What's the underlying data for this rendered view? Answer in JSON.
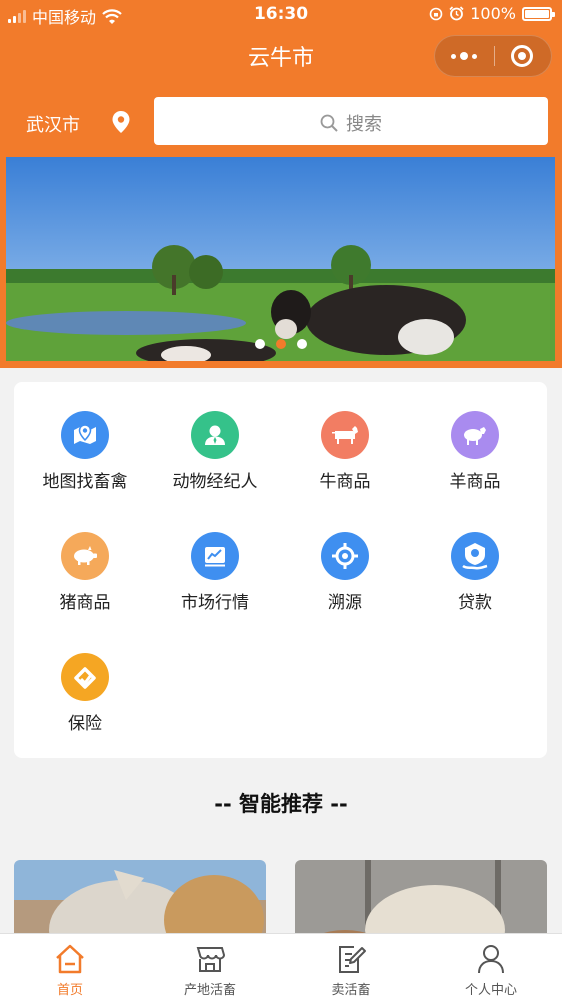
{
  "status_bar": {
    "carrier": "中国移动",
    "time": "16:30",
    "battery": "100%"
  },
  "nav": {
    "title": "云牛市"
  },
  "location": {
    "city": "武汉市"
  },
  "search": {
    "placeholder": "搜索"
  },
  "banner": {
    "slide_count": 3,
    "active_index": 1
  },
  "categories": [
    {
      "label": "地图找畜禽",
      "icon": "map-pin-icon",
      "color": "#3f8ff0"
    },
    {
      "label": "动物经纪人",
      "icon": "person-icon",
      "color": "#35c28a"
    },
    {
      "label": "牛商品",
      "icon": "cow-icon",
      "color": "#f27d63"
    },
    {
      "label": "羊商品",
      "icon": "sheep-icon",
      "color": "#a98bef"
    },
    {
      "label": "猪商品",
      "icon": "pig-icon",
      "color": "#f5a95a"
    },
    {
      "label": "市场行情",
      "icon": "chart-icon",
      "color": "#3f8ff0"
    },
    {
      "label": "溯源",
      "icon": "target-icon",
      "color": "#3f8ff0"
    },
    {
      "label": "贷款",
      "icon": "loan-icon",
      "color": "#3f8ff0"
    },
    {
      "label": "保险",
      "icon": "insurance-icon",
      "color": "#f5a623"
    }
  ],
  "recommend": {
    "title": "-- 智能推荐 --"
  },
  "tabs": [
    {
      "label": "首页",
      "icon": "home-icon",
      "active": true
    },
    {
      "label": "产地活畜",
      "icon": "store-icon",
      "active": false
    },
    {
      "label": "卖活畜",
      "icon": "edit-icon",
      "active": false
    },
    {
      "label": "个人中心",
      "icon": "user-icon",
      "active": false
    }
  ],
  "colors": {
    "brand": "#f27b2b",
    "background": "#f2f2f2"
  }
}
